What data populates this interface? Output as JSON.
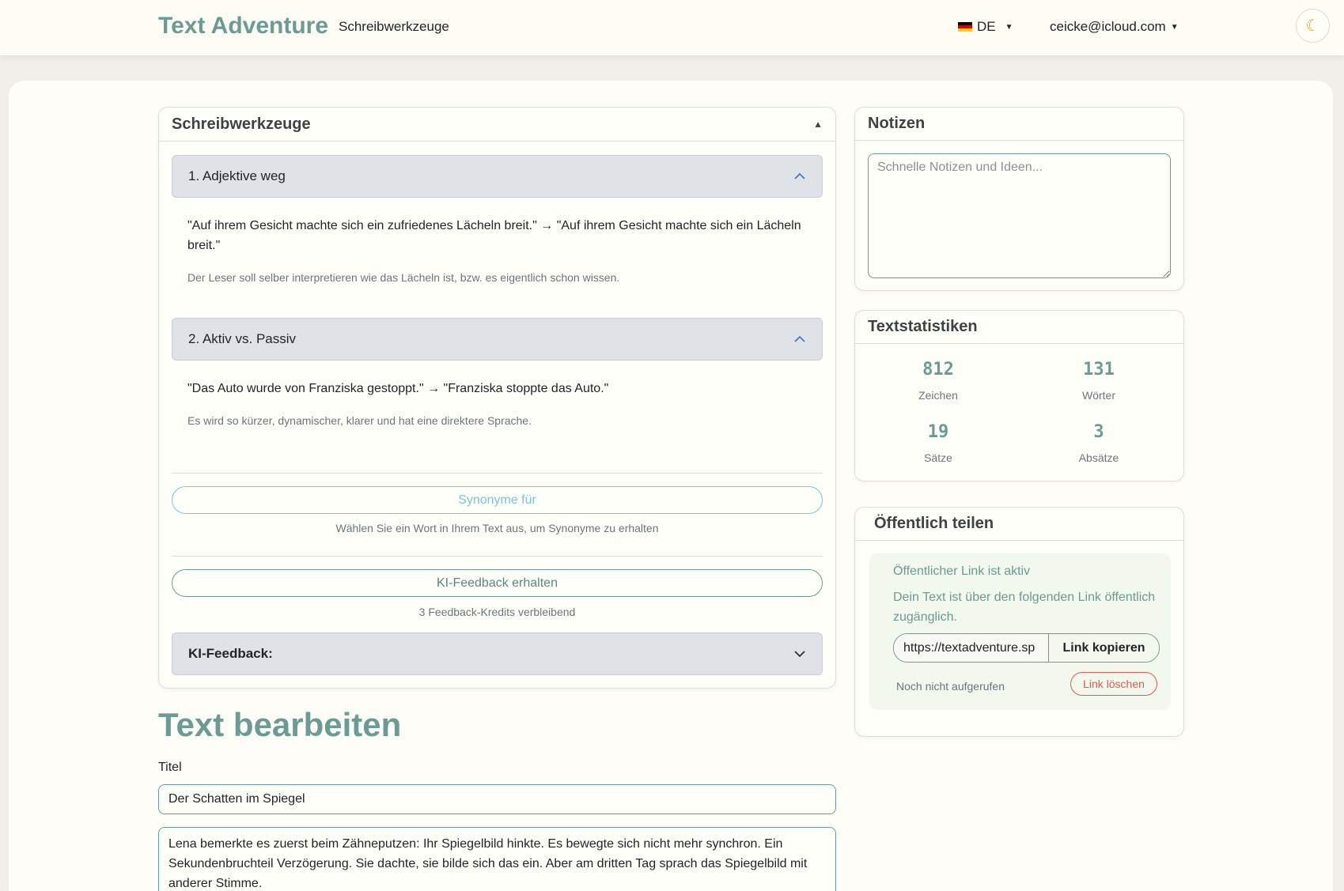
{
  "navbar": {
    "brand": "Text Adventure",
    "link": "Schreibwerkzeuge",
    "language": "DE",
    "user": "ceicke@icloud.com",
    "theme_icon": "moon-icon"
  },
  "tools": {
    "title": "Schreibwerkzeuge",
    "items": [
      {
        "heading": "1. Adjektive weg",
        "example": "\"Auf ihrem Gesicht machte sich ein zufriedenes Lächeln breit.\" → \"Auf ihrem Gesicht machte sich ein Lächeln breit.\"",
        "note": "Der Leser soll selber interpretieren wie das Lächeln ist, bzw. es eigentlich schon wissen."
      },
      {
        "heading": "2. Aktiv vs. Passiv",
        "example": "\"Das Auto wurde von Franziska gestoppt.\" → \"Franziska stoppte das Auto.\"",
        "note": "Es wird so kürzer, dynamischer, klarer und hat eine direktere Sprache."
      }
    ],
    "synonyms_button": "Synonyme für",
    "synonyms_hint": "Wählen Sie ein Wort in Ihrem Text aus, um Synonyme zu erhalten",
    "ki_button": "KI-Feedback erhalten",
    "ki_credits": "3 Feedback-Kredits verbleibend",
    "ki_section": "KI-Feedback:"
  },
  "editor": {
    "heading": "Text bearbeiten",
    "title_label": "Titel",
    "title_value": "Der Schatten im Spiegel",
    "body": "Lena bemerkte es zuerst beim Zähneputzen: Ihr Spiegelbild hinkte. Es bewegte sich nicht mehr synchron. Ein Sekundenbruchteil Verzögerung. Sie dachte, sie bilde sich das ein. Aber am dritten Tag sprach das Spiegelbild mit anderer Stimme."
  },
  "notes": {
    "title": "Notizen",
    "placeholder": "Schnelle Notizen und Ideen..."
  },
  "stats": {
    "title": "Textstatistiken",
    "chars_value": "812",
    "chars_label": "Zeichen",
    "words_value": "131",
    "words_label": "Wörter",
    "sentences_value": "19",
    "sentences_label": "Sätze",
    "paragraphs_value": "3",
    "paragraphs_label": "Absätze"
  },
  "share": {
    "title": "Öffentlich teilen",
    "status": "Öffentlicher Link ist aktiv",
    "description": "Dein Text ist über den folgenden Link öffentlich zugänglich.",
    "link_value": "https://textadventure.sp",
    "copy_button": "Link kopieren",
    "views": "Noch nicht aufgerufen",
    "delete_button": "Link löschen"
  },
  "colors": {
    "brand": "#6b9b95",
    "info": "#74c7dc",
    "danger": "#e05a4f"
  }
}
